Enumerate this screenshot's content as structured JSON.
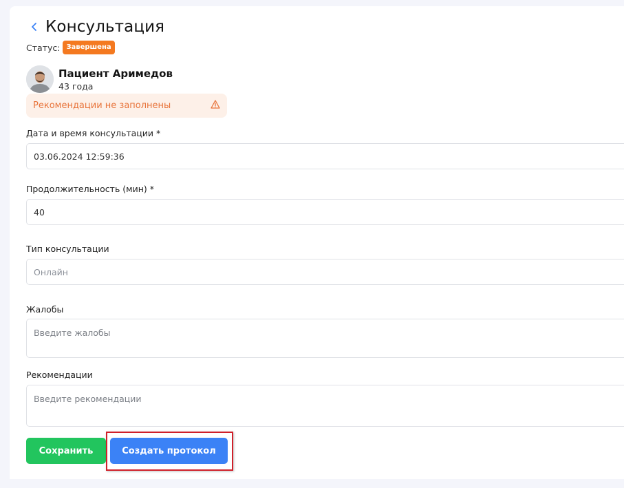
{
  "header": {
    "title": "Консультация",
    "back_icon": "chevron-left-icon"
  },
  "status": {
    "label": "Статус:",
    "value": "Завершена",
    "color": "#f47920"
  },
  "patient": {
    "name": "Пациент Аримедов",
    "age": "43 года"
  },
  "warning": {
    "text": "Рекомендации не заполнены",
    "icon": "warning-triangle-icon"
  },
  "form": {
    "datetime": {
      "label": "Дата и время консультации *",
      "value": "03.06.2024 12:59:36"
    },
    "duration": {
      "label": "Продолжительность (мин) *",
      "value": "40"
    },
    "type": {
      "label": "Тип консультации",
      "value": "Онлайн"
    },
    "complaints": {
      "label": "Жалобы",
      "placeholder": "Введите жалобы"
    },
    "recommendations": {
      "label": "Рекомендации",
      "placeholder": "Введите рекомендации"
    }
  },
  "actions": {
    "save_label": "Сохранить",
    "protocol_label": "Создать протокол"
  },
  "colors": {
    "save": "#22c55e",
    "primary": "#3b82f6",
    "warning": "#e8743b",
    "highlight": "#d0202a"
  }
}
